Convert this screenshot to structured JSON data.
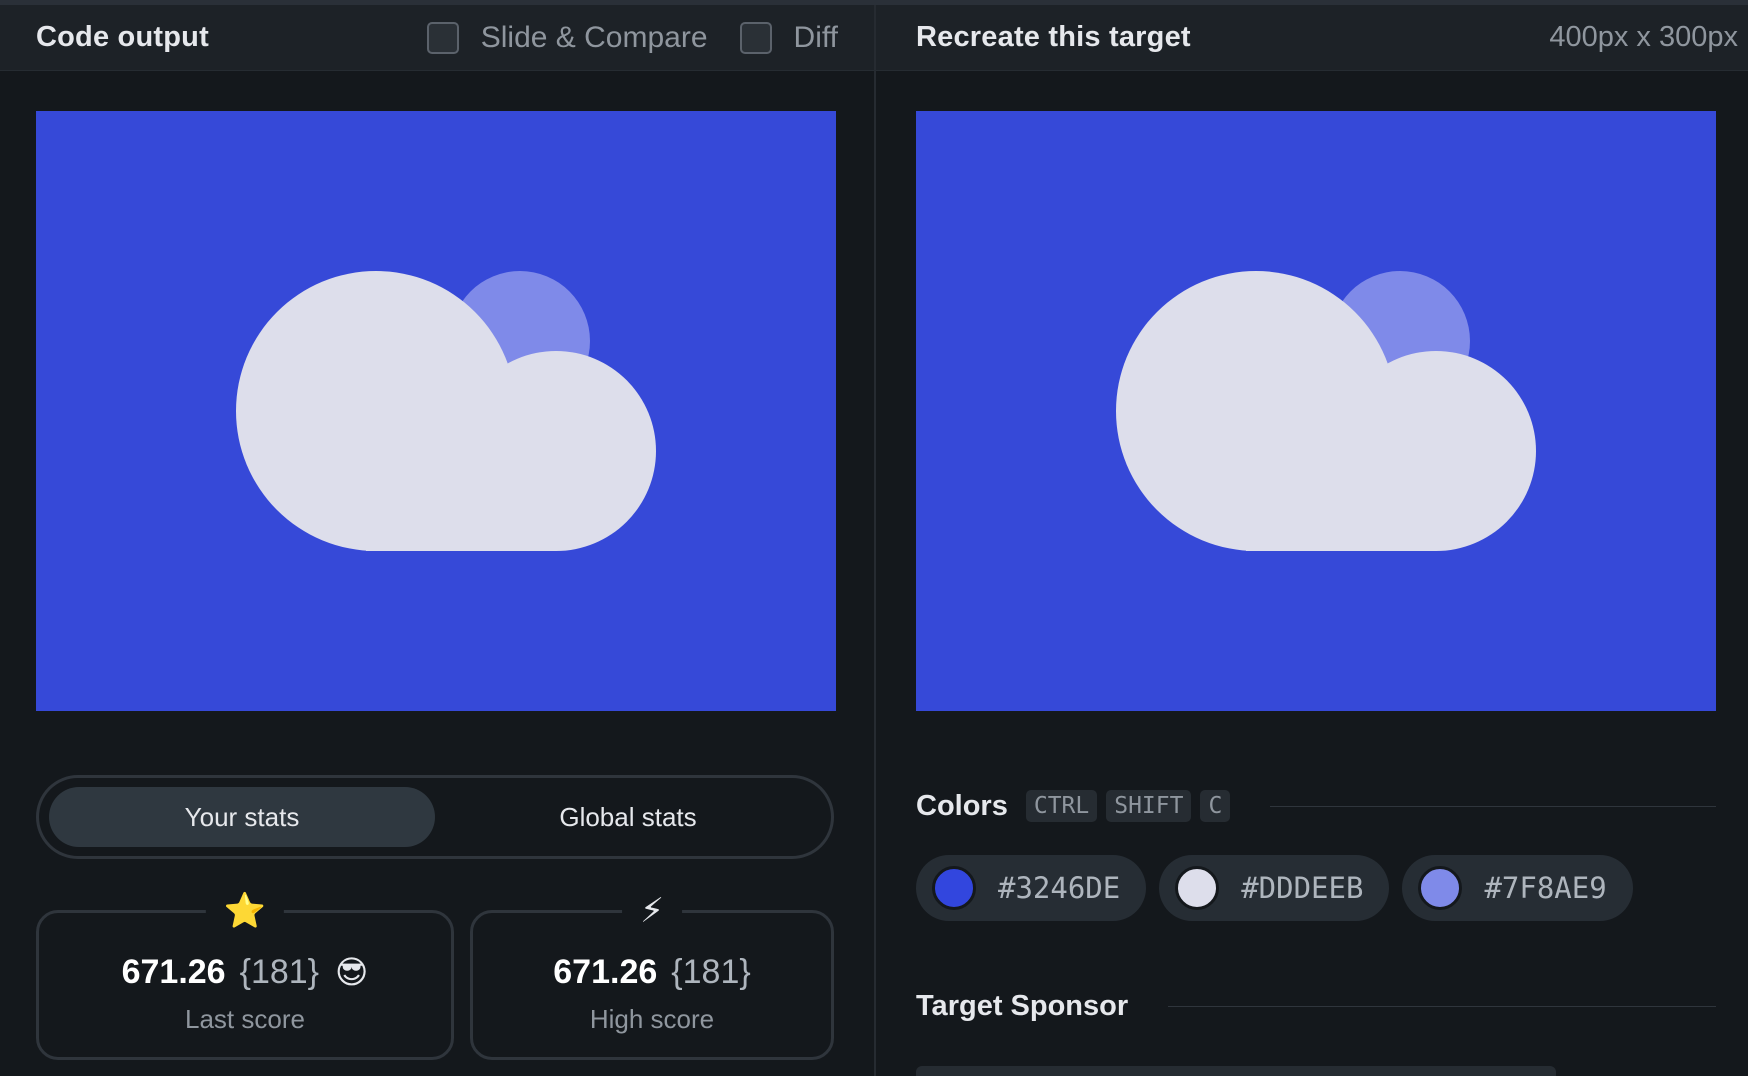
{
  "left_header": {
    "title": "Code output",
    "slide_compare_label": "Slide & Compare",
    "diff_label": "Diff"
  },
  "right_header": {
    "title": "Recreate this target",
    "dimensions": "400px x 300px"
  },
  "stats_tabs": {
    "your_stats": "Your stats",
    "global_stats": "Global stats",
    "active": "your_stats"
  },
  "last_score": {
    "badge": "⭐",
    "score": "671.26",
    "count": "{181}",
    "emoji": "😎",
    "label": "Last score"
  },
  "high_score": {
    "badge": "⚡",
    "score": "671.26",
    "count": "{181}",
    "label": "High score"
  },
  "colors": {
    "title": "Colors",
    "shortcut": [
      "CTRL",
      "SHIFT",
      "C"
    ],
    "swatches": [
      {
        "hex": "#3246DE",
        "color": "#3246DE"
      },
      {
        "hex": "#DDDEEB",
        "color": "#DDDEEB"
      },
      {
        "hex": "#7F8AE9",
        "color": "#7F8AE9"
      }
    ]
  },
  "sponsor": {
    "title": "Target Sponsor"
  }
}
